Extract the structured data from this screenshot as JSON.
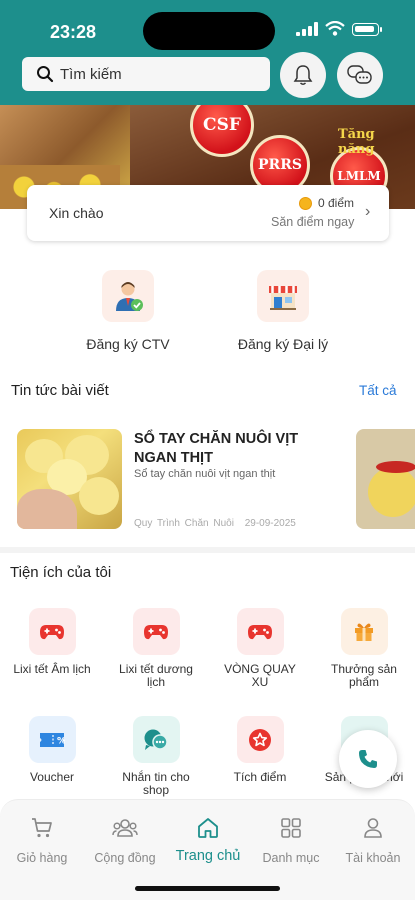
{
  "status_bar": {
    "time": "23:28"
  },
  "search": {
    "placeholder": "Tìm kiếm"
  },
  "banner": {
    "badge_csf": "CSF",
    "badge_prrs": "PRRS",
    "badge_lmlm": "LMLM",
    "tagline": "Tăng năng"
  },
  "greeting": {
    "hello": "Xin chào",
    "points": "0 điểm",
    "earn": "Săn điểm ngay"
  },
  "register": [
    {
      "label": "Đăng ký CTV"
    },
    {
      "label": "Đăng ký Đại lý"
    }
  ],
  "news": {
    "title": "Tin tức bài viết",
    "see_all": "Tất cả",
    "article": {
      "title": "SỔ TAY CHĂN NUÔI VỊT NGAN THỊT",
      "subtitle": "Sổ tay chăn nuôi vịt ngan thịt",
      "category": "Quy Trình Chăn Nuôi",
      "date": "29-09-2025"
    }
  },
  "utilities": {
    "title": "Tiện ích của tôi",
    "items": [
      {
        "label": "Lixi tết Âm lịch",
        "icon": "gamepad-icon"
      },
      {
        "label": "Lixi tết dương lịch",
        "icon": "gamepad-icon"
      },
      {
        "label": "VÒNG QUAY XU",
        "icon": "gamepad-icon"
      },
      {
        "label": "Thưởng sản phẩm",
        "icon": "gift-icon"
      },
      {
        "label": "Voucher",
        "icon": "voucher-icon"
      },
      {
        "label": "Nhắn tin cho shop",
        "icon": "chat-icon"
      },
      {
        "label": "Tích điểm",
        "icon": "star-icon"
      },
      {
        "label": "Sản phẩm mới",
        "icon": "new-product-icon"
      }
    ]
  },
  "bottom_nav": [
    {
      "label": "Giỏ hàng",
      "icon": "cart-icon"
    },
    {
      "label": "Cộng đồng",
      "icon": "community-icon"
    },
    {
      "label": "Trang chủ",
      "icon": "home-icon",
      "active": true
    },
    {
      "label": "Danh mục",
      "icon": "grid-icon"
    },
    {
      "label": "Tài khoản",
      "icon": "user-icon"
    }
  ],
  "colors": {
    "primary": "#1d8f8c",
    "link": "#2a7ad8",
    "icon_red": "#e8352f"
  }
}
